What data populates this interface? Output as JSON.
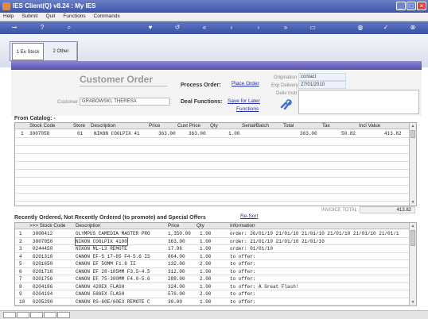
{
  "window": {
    "title": "IES Client(Q) v8.24 : My IES",
    "min": "_",
    "max": "□",
    "close": "×"
  },
  "menu": [
    "Help",
    "Submit",
    "Quit",
    "Functions",
    "Commands"
  ],
  "toolbar_icons": [
    "key-icon",
    "help-icon",
    "search-icon",
    "heart-icon",
    "undo-icon",
    "first-icon",
    "prev-icon",
    "next-icon",
    "last-icon",
    "page-icon",
    "globe-icon",
    "check-icon",
    "close-icon"
  ],
  "tabs": [
    {
      "label": "1 Ex Stock"
    },
    {
      "label": "2 Other"
    }
  ],
  "header": {
    "title": "Customer Order",
    "customer_label": "Customer",
    "customer_value": "GRABOWSKI, THERESA",
    "process_order_label": "Process Order:",
    "place_order_link": "Place Order",
    "deal_functions_label": "Deal Functions:",
    "save_later_link": "Save for Later",
    "functions_link": "Functions",
    "origination_label": "Origination",
    "origination_value": "contact",
    "exp_delivery_label": "Exp Delivery",
    "exp_delivery_value": "27/01/2010",
    "deliv_instr_label": "Deliv Instr",
    "deliv_instr_value": ""
  },
  "catalog": {
    "section_label": "From Catalog: -",
    "columns": [
      "Stock Code",
      "Store",
      "Description",
      "Price",
      "Cust Price",
      "Qty",
      "Serial/Batch",
      "Total",
      "Tax",
      "Incl Value"
    ],
    "rows": [
      {
        "idx": "1",
        "code": "3007058",
        "store": "01",
        "desc": "NIKON COOLPIX 41",
        "price": "363.00",
        "cust_price": "363.00",
        "qty": "1.00",
        "serial": "",
        "total": "363.00",
        "tax": "50.82",
        "incl": "413.82"
      }
    ],
    "invoice_total_label": "INVOICE TOTAL",
    "invoice_total": "413.82"
  },
  "recent": {
    "section_label": "Recently Ordered, Not Recently Ordered (to promote) and Special Offers",
    "resort_link": "Re-Sort",
    "columns": [
      ">>> Stock Code",
      "Description",
      "Price",
      "Qty",
      "Information"
    ],
    "rows": [
      {
        "idx": "1",
        "code": "3008412",
        "desc": "OLYMPUS CAMEDIA MASTER PRO",
        "price": "1,350.00",
        "qty": "1.00",
        "info": "order: 26/01/10 21/01/10 21/01/10 21/01/10 21/01/10 21/01/1"
      },
      {
        "idx": "2",
        "code": "3007058",
        "desc": "NIKON COOLPIX 4100",
        "price": "363.00",
        "qty": "1.00",
        "info": "order: 21/01/10 21/01/10 21/01/10"
      },
      {
        "idx": "3",
        "code": "0244450",
        "desc": "NIKON ML-L3 REMOTE",
        "price": "17.96",
        "qty": "1.00",
        "info": "order: 01/01/10"
      },
      {
        "idx": "4",
        "code": "0201310",
        "desc": "CANON EF-S 17-85 F4-5.6 IS",
        "price": "864.00",
        "qty": "1.00",
        "info": "to offer:"
      },
      {
        "idx": "5",
        "code": "0201650",
        "desc": "CANON EF 50MM F1.8 II",
        "price": "132.00",
        "qty": "2.00",
        "info": "to offer:"
      },
      {
        "idx": "6",
        "code": "0201718",
        "desc": "CANON EF 28-105MM F3.5-4.5",
        "price": "312.00",
        "qty": "1.00",
        "info": "to offer:"
      },
      {
        "idx": "7",
        "code": "0201756",
        "desc": "CANON EF 75-300MM F4.0-5.6",
        "price": "288.00",
        "qty": "2.00",
        "info": "to offer:"
      },
      {
        "idx": "8",
        "code": "0204186",
        "desc": "CANON 420EX FLASH",
        "price": "324.00",
        "qty": "1.00",
        "info": "to offer: A Great Flash!"
      },
      {
        "idx": "9",
        "code": "0204194",
        "desc": "CANON 580EX FLASH",
        "price": "576.00",
        "qty": "2.00",
        "info": "to offer:"
      },
      {
        "idx": "10",
        "code": "0205290",
        "desc": "CANON RS-60E/60E3 REMOTE C",
        "price": "30.00",
        "qty": "1.00",
        "info": "to offer:"
      }
    ]
  },
  "colors": {
    "titlebar": "#3d55a8",
    "band": "#5850b0",
    "link": "#2030b0"
  }
}
